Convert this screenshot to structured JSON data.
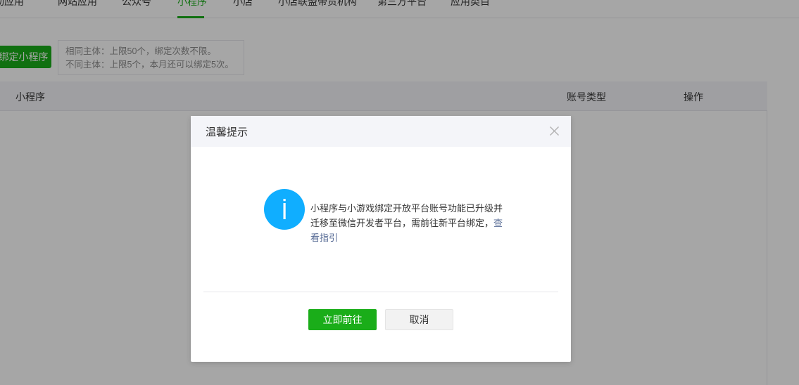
{
  "tabs": [
    {
      "label": "移动应用",
      "active": false
    },
    {
      "label": "网站应用",
      "active": false
    },
    {
      "label": "公众号",
      "active": false
    },
    {
      "label": "小程序",
      "active": true
    },
    {
      "label": "小店",
      "active": false
    },
    {
      "label": "小店联盟带货机构",
      "active": false
    },
    {
      "label": "第三方平台",
      "active": false
    },
    {
      "label": "应用类目",
      "active": false
    }
  ],
  "bind": {
    "button_label": "绑定小程序",
    "note_line1": "相同主体：上限50个，绑定次数不限。",
    "note_line2": "不同主体：上限5个，本月还可以绑定5次。"
  },
  "table": {
    "columns": [
      "小程序",
      "账号类型",
      "操作"
    ]
  },
  "dialog": {
    "title": "温馨提示",
    "message": "小程序与小游戏绑定开放平台账号功能已升级并迁移至微信开发者平台，需前往新平台绑定，",
    "link_text": "查看指引",
    "confirm_label": "立即前往",
    "cancel_label": "取消"
  },
  "colors": {
    "brand_green": "#1aad19",
    "info_blue": "#10aeff",
    "link": "#576b95"
  },
  "icons": {
    "close": "close-icon",
    "info": "info-icon"
  }
}
